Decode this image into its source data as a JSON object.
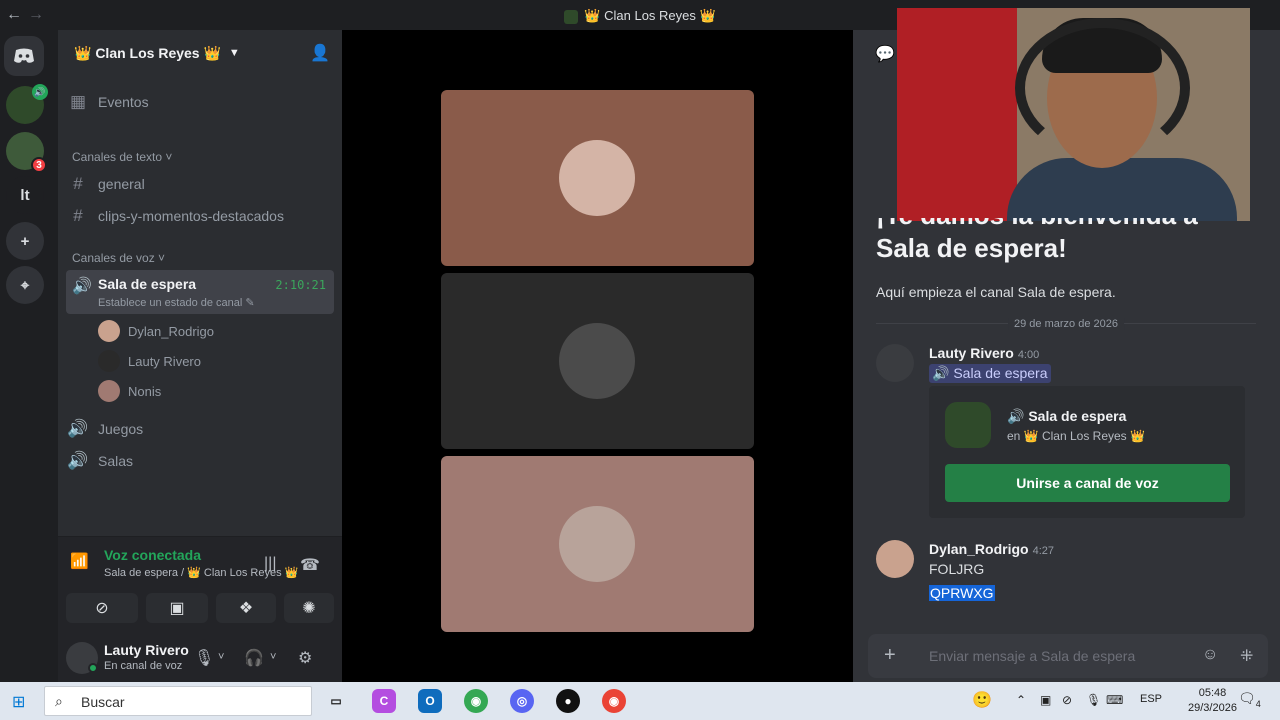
{
  "window": {
    "back": "←",
    "forward": "→",
    "title": "👑 Clan Los Reyes 👑"
  },
  "guilds": [
    {
      "label": "",
      "badge": ""
    },
    {
      "label": "",
      "badge": "3"
    },
    {
      "label": "lt",
      "badge": ""
    },
    {
      "label": "+",
      "badge": ""
    },
    {
      "label": "⌖",
      "badge": ""
    }
  ],
  "server": {
    "name": "👑 Clan Los Reyes 👑",
    "events": "Eventos",
    "text_category": "Canales de texto",
    "text_channels": [
      "general",
      "clips-y-momentos-destacados"
    ],
    "voice_category": "Canales de voz",
    "active_voice": {
      "name": "Sala de espera",
      "status": "Establece un estado de canal",
      "timer": "2:10:21",
      "users": [
        "Dylan_Rodrigo",
        "Lauty Rivero",
        "Nonis"
      ]
    },
    "other_voice": [
      "Juegos",
      "Salas"
    ]
  },
  "rtc": {
    "status": "Voz conectada",
    "location": "Sala de espera / 👑 Clan Los Reyes 👑"
  },
  "user": {
    "name": "Lauty Rivero",
    "status": "En canal de voz"
  },
  "chat": {
    "welcome_title_line1": "¡Te damos la bienvenida a",
    "welcome_title_line2": "Sala de espera!",
    "welcome_sub": "Aquí empieza el canal Sala de espera.",
    "date_divider": "29 de marzo de 2026",
    "messages": [
      {
        "author": "Lauty Rivero",
        "time": "4:00",
        "mention": "🔊 Sala de espera",
        "embed": {
          "title": "🔊 Sala de espera",
          "subtitle": "en 👑 Clan Los Reyes 👑",
          "button": "Unirse a canal de voz"
        }
      },
      {
        "author": "Dylan_Rodrigo",
        "time": "4:27",
        "lines": [
          "FOLJRG",
          "QPRWXG"
        ]
      }
    ],
    "composer_placeholder": "Enviar mensaje a Sala de espera"
  },
  "taskbar": {
    "search": "Buscar",
    "lang": "ESP",
    "time": "05:48",
    "date": "29/3/2026",
    "notif_count": "4"
  },
  "colors": {
    "accent_green": "#23a55a",
    "join_button": "#248046",
    "mention_bg": "#3c4270"
  }
}
